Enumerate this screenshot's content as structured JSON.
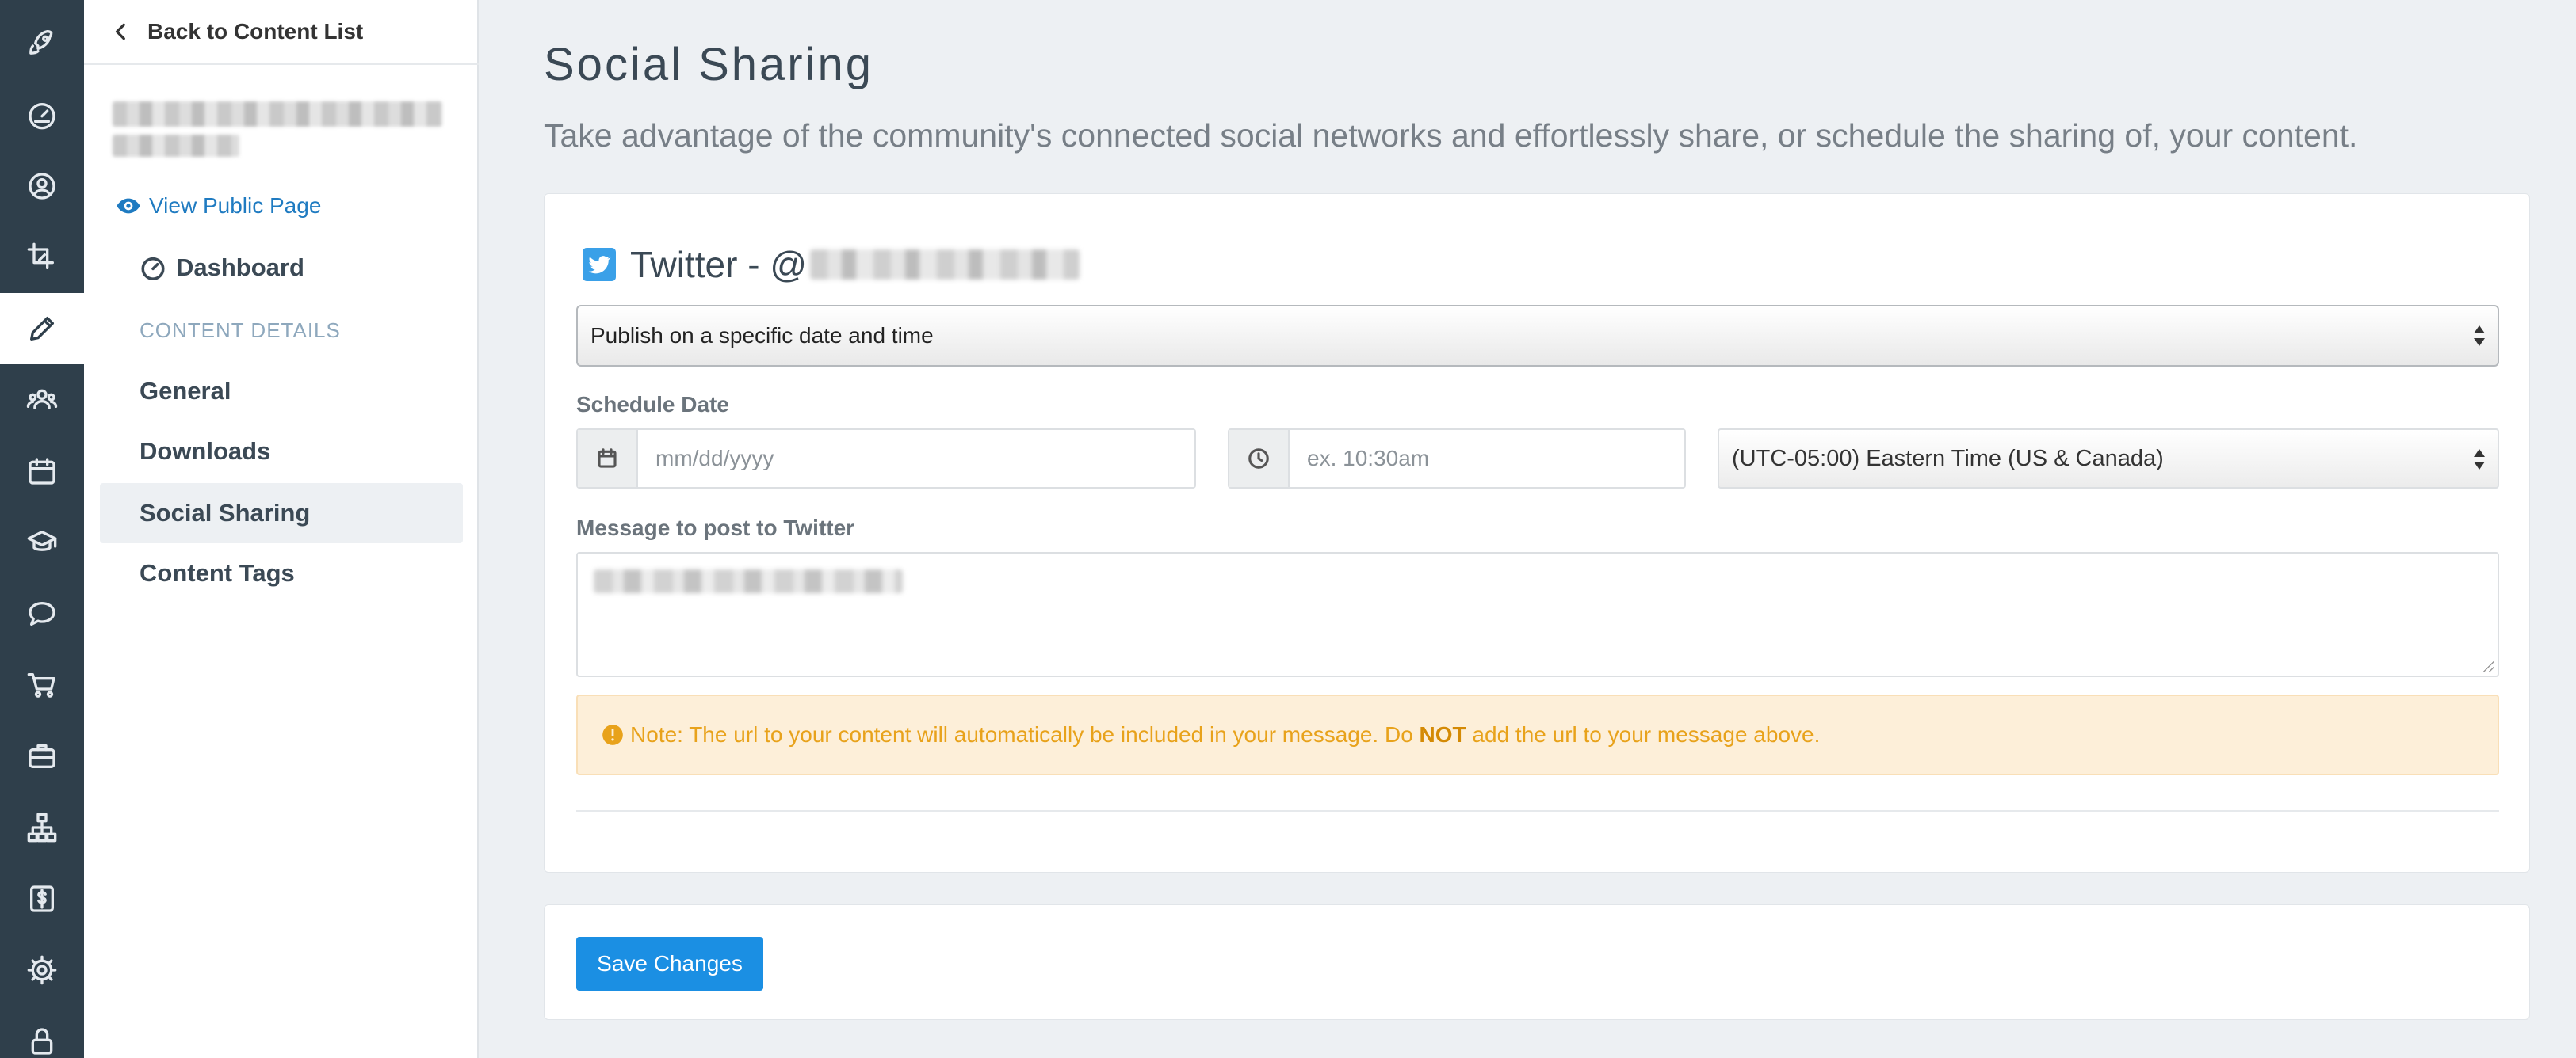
{
  "rail": {
    "icons": [
      "rocket-icon",
      "speedometer-icon",
      "user-circle-icon",
      "crop-icon",
      "pencil-icon",
      "people-icon",
      "calendar-icon",
      "graduation-cap-icon",
      "chat-bubble-icon",
      "cart-icon",
      "briefcase-icon",
      "sitemap-icon",
      "dollar-icon",
      "gear-icon",
      "lock-icon"
    ],
    "active": "pencil-icon"
  },
  "sidebar": {
    "back_label": "Back to Content List",
    "view_public_label": "View Public Page",
    "dashboard_label": "Dashboard",
    "section_label": "CONTENT DETAILS",
    "items": [
      {
        "label": "General",
        "active": false
      },
      {
        "label": "Downloads",
        "active": false
      },
      {
        "label": "Social Sharing",
        "active": true
      },
      {
        "label": "Content Tags",
        "active": false
      }
    ]
  },
  "main": {
    "title": "Social Sharing",
    "subtitle": "Take advantage of the community's connected social networks and effortlessly share, or schedule the sharing of, your content.",
    "twitter": {
      "heading": "Twitter - @",
      "publish_option": "Publish on a specific date and time",
      "schedule_label": "Schedule Date",
      "date_placeholder": "mm/dd/yyyy",
      "time_placeholder": "ex. 10:30am",
      "timezone": "(UTC-05:00) Eastern Time (US & Canada)",
      "message_label": "Message to post to Twitter",
      "note_prefix": "Note: The url to your content will automatically be included in your message. Do ",
      "note_bold": "NOT",
      "note_suffix": " add the url to your message above."
    },
    "save_label": "Save Changes"
  },
  "colors": {
    "rail_bg": "#2f3f4b",
    "accent": "#1b8fe3",
    "link": "#1f7bc1",
    "twitter": "#3aa0e8",
    "warning_bg": "#fdefd9",
    "warning_text": "#e8a21b"
  }
}
